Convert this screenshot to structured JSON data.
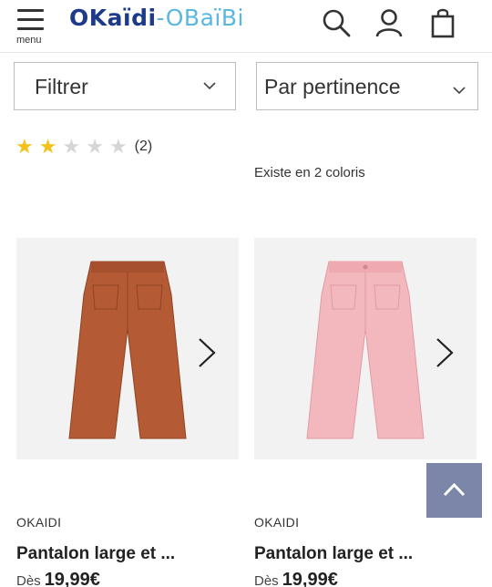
{
  "header": {
    "menu_label": "menu",
    "logo_left": "OKaïdi",
    "logo_sep": "-",
    "logo_right": "OBaïBi",
    "icons": [
      "menu-icon",
      "search-icon",
      "user-icon",
      "shopping-bag-icon"
    ]
  },
  "filters": {
    "filter_label": "Filtrer",
    "sort_label": "Par pertinence"
  },
  "previous_row": {
    "left_rating": {
      "stars": 2,
      "max": 5,
      "count": "(2)"
    },
    "right_note": "Existe en 2 coloris"
  },
  "products": [
    {
      "brand": "OKAIDI",
      "title": "Pantalon large et ...",
      "price_prefix": "Dès",
      "price": "19,99€",
      "color": "#b45a34"
    },
    {
      "brand": "OKAIDI",
      "title": "Pantalon large et ...",
      "price_prefix": "Dès",
      "price": "19,99€",
      "color": "#f3b8bd"
    }
  ],
  "colors": {
    "logo_primary": "#1e3a8a",
    "logo_secondary": "#5cb7e0",
    "star_on": "#f3c21a",
    "star_off": "#d6d6d6",
    "back_to_top": "#7c86a8"
  }
}
